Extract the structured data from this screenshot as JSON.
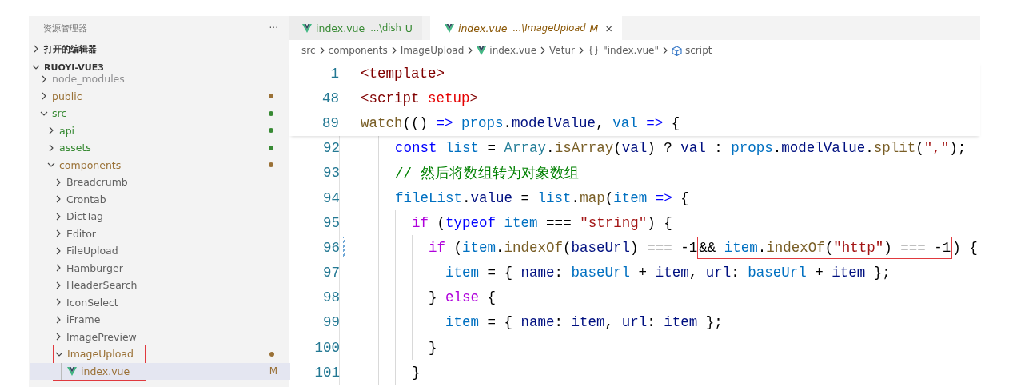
{
  "sidebar": {
    "title": "资源管理器",
    "more": "···",
    "sections": [
      {
        "label": "打开的编辑器",
        "expanded": false
      },
      {
        "label": "RUOYI-VUE3",
        "expanded": true
      }
    ],
    "tree": [
      {
        "label": "node_modules",
        "kind": "folder",
        "expanded": false,
        "color": "#8e8e90",
        "dot": false,
        "selected": false,
        "annotated": false
      },
      {
        "label": "public",
        "kind": "folder",
        "expanded": false,
        "color": "#9a7136",
        "dot": true,
        "selected": false,
        "annotated": false
      },
      {
        "label": "src",
        "kind": "folder",
        "expanded": true,
        "color": "#388a34",
        "dot": true,
        "selected": false,
        "annotated": false,
        "children": [
          {
            "label": "api",
            "kind": "folder",
            "expanded": false,
            "color": "#388a34",
            "dot": true,
            "selected": false,
            "annotated": false
          },
          {
            "label": "assets",
            "kind": "folder",
            "expanded": false,
            "color": "#388a34",
            "dot": true,
            "selected": false,
            "annotated": false
          },
          {
            "label": "components",
            "kind": "folder",
            "expanded": true,
            "color": "#9a7136",
            "dot": true,
            "selected": false,
            "annotated": false,
            "children": [
              {
                "label": "Breadcrumb",
                "kind": "folder",
                "expanded": false,
                "selected": false,
                "annotated": false
              },
              {
                "label": "Crontab",
                "kind": "folder",
                "expanded": false,
                "selected": false,
                "annotated": false
              },
              {
                "label": "DictTag",
                "kind": "folder",
                "expanded": false,
                "selected": false,
                "annotated": false
              },
              {
                "label": "Editor",
                "kind": "folder",
                "expanded": false,
                "selected": false,
                "annotated": false
              },
              {
                "label": "FileUpload",
                "kind": "folder",
                "expanded": false,
                "selected": false,
                "annotated": false
              },
              {
                "label": "Hamburger",
                "kind": "folder",
                "expanded": false,
                "selected": false,
                "annotated": false
              },
              {
                "label": "HeaderSearch",
                "kind": "folder",
                "expanded": false,
                "selected": false,
                "annotated": false
              },
              {
                "label": "IconSelect",
                "kind": "folder",
                "expanded": false,
                "selected": false,
                "annotated": false
              },
              {
                "label": "iFrame",
                "kind": "folder",
                "expanded": false,
                "selected": false,
                "annotated": false
              },
              {
                "label": "ImagePreview",
                "kind": "folder",
                "expanded": false,
                "selected": false,
                "annotated": false
              },
              {
                "label": "ImageUpload",
                "kind": "folder",
                "expanded": true,
                "color": "#9a7136",
                "dot": true,
                "selected": false,
                "annotated": true,
                "children": [
                  {
                    "label": "index.vue",
                    "kind": "file",
                    "color": "#9a7136",
                    "dot": false,
                    "badge": "M",
                    "selected": true,
                    "annotated": true
                  }
                ]
              }
            ]
          }
        ]
      }
    ]
  },
  "tabs": [
    {
      "label": "index.vue",
      "path": "...\\dish",
      "badge": "U",
      "color": "#388a34",
      "selected": false,
      "preview": false
    },
    {
      "label": "index.vue",
      "path": "...\\ImageUpload",
      "badge": "M",
      "color": "#895503",
      "selected": true,
      "preview": true,
      "close": "×"
    }
  ],
  "breadcrumb": [
    {
      "label": "src",
      "kind": "folder"
    },
    {
      "label": "components",
      "kind": "folder"
    },
    {
      "label": "ImageUpload",
      "kind": "folder"
    },
    {
      "label": "index.vue",
      "kind": "file"
    },
    {
      "label": "Vetur",
      "kind": "folder"
    },
    {
      "label": "\"index.vue\"",
      "kind": "object",
      "glyph": "{}"
    },
    {
      "label": "script",
      "kind": "symbol"
    }
  ],
  "sticky_lines": [
    {
      "number": "1",
      "segments": [
        {
          "text": "<template>"
        }
      ]
    },
    {
      "number": "48",
      "segments": [
        {
          "text": "<script setup>"
        }
      ]
    },
    {
      "number": "89",
      "segments": [
        {
          "text": "watch(() => props.modelValue, val => {"
        }
      ]
    }
  ],
  "lines": [
    {
      "number": "92",
      "segments": [
        {
          "text": "    const list = Array.isArray(val) ? val : props.modelValue.split(\",\");"
        }
      ]
    },
    {
      "number": "93",
      "segments": [
        {
          "text": "    // 然后将数组转为对象数组"
        }
      ]
    },
    {
      "number": "94",
      "segments": [
        {
          "text": "    fileList.value = list.map(item => {"
        }
      ]
    },
    {
      "number": "95",
      "segments": [
        {
          "text": "      if (typeof item === \"string\") {"
        }
      ]
    },
    {
      "number": "96",
      "changed": true,
      "segments": [
        {
          "text": "        if (item.indexOf(baseUrl) === -1",
          "boxed": false
        },
        {
          "text": "&& item.indexOf(\"http\") === -1",
          "boxed": true
        },
        {
          "text": ") {",
          "boxed": false
        }
      ]
    },
    {
      "number": "97",
      "segments": [
        {
          "text": "          item = { name: baseUrl + item, url: baseUrl + item };"
        }
      ]
    },
    {
      "number": "98",
      "segments": [
        {
          "text": "        } else {"
        }
      ]
    },
    {
      "number": "99",
      "segments": [
        {
          "text": "          item = { name: item, url: item };"
        }
      ]
    },
    {
      "number": "100",
      "segments": [
        {
          "text": "        }"
        }
      ]
    },
    {
      "number": "101",
      "segments": [
        {
          "text": "      }"
        }
      ]
    }
  ]
}
